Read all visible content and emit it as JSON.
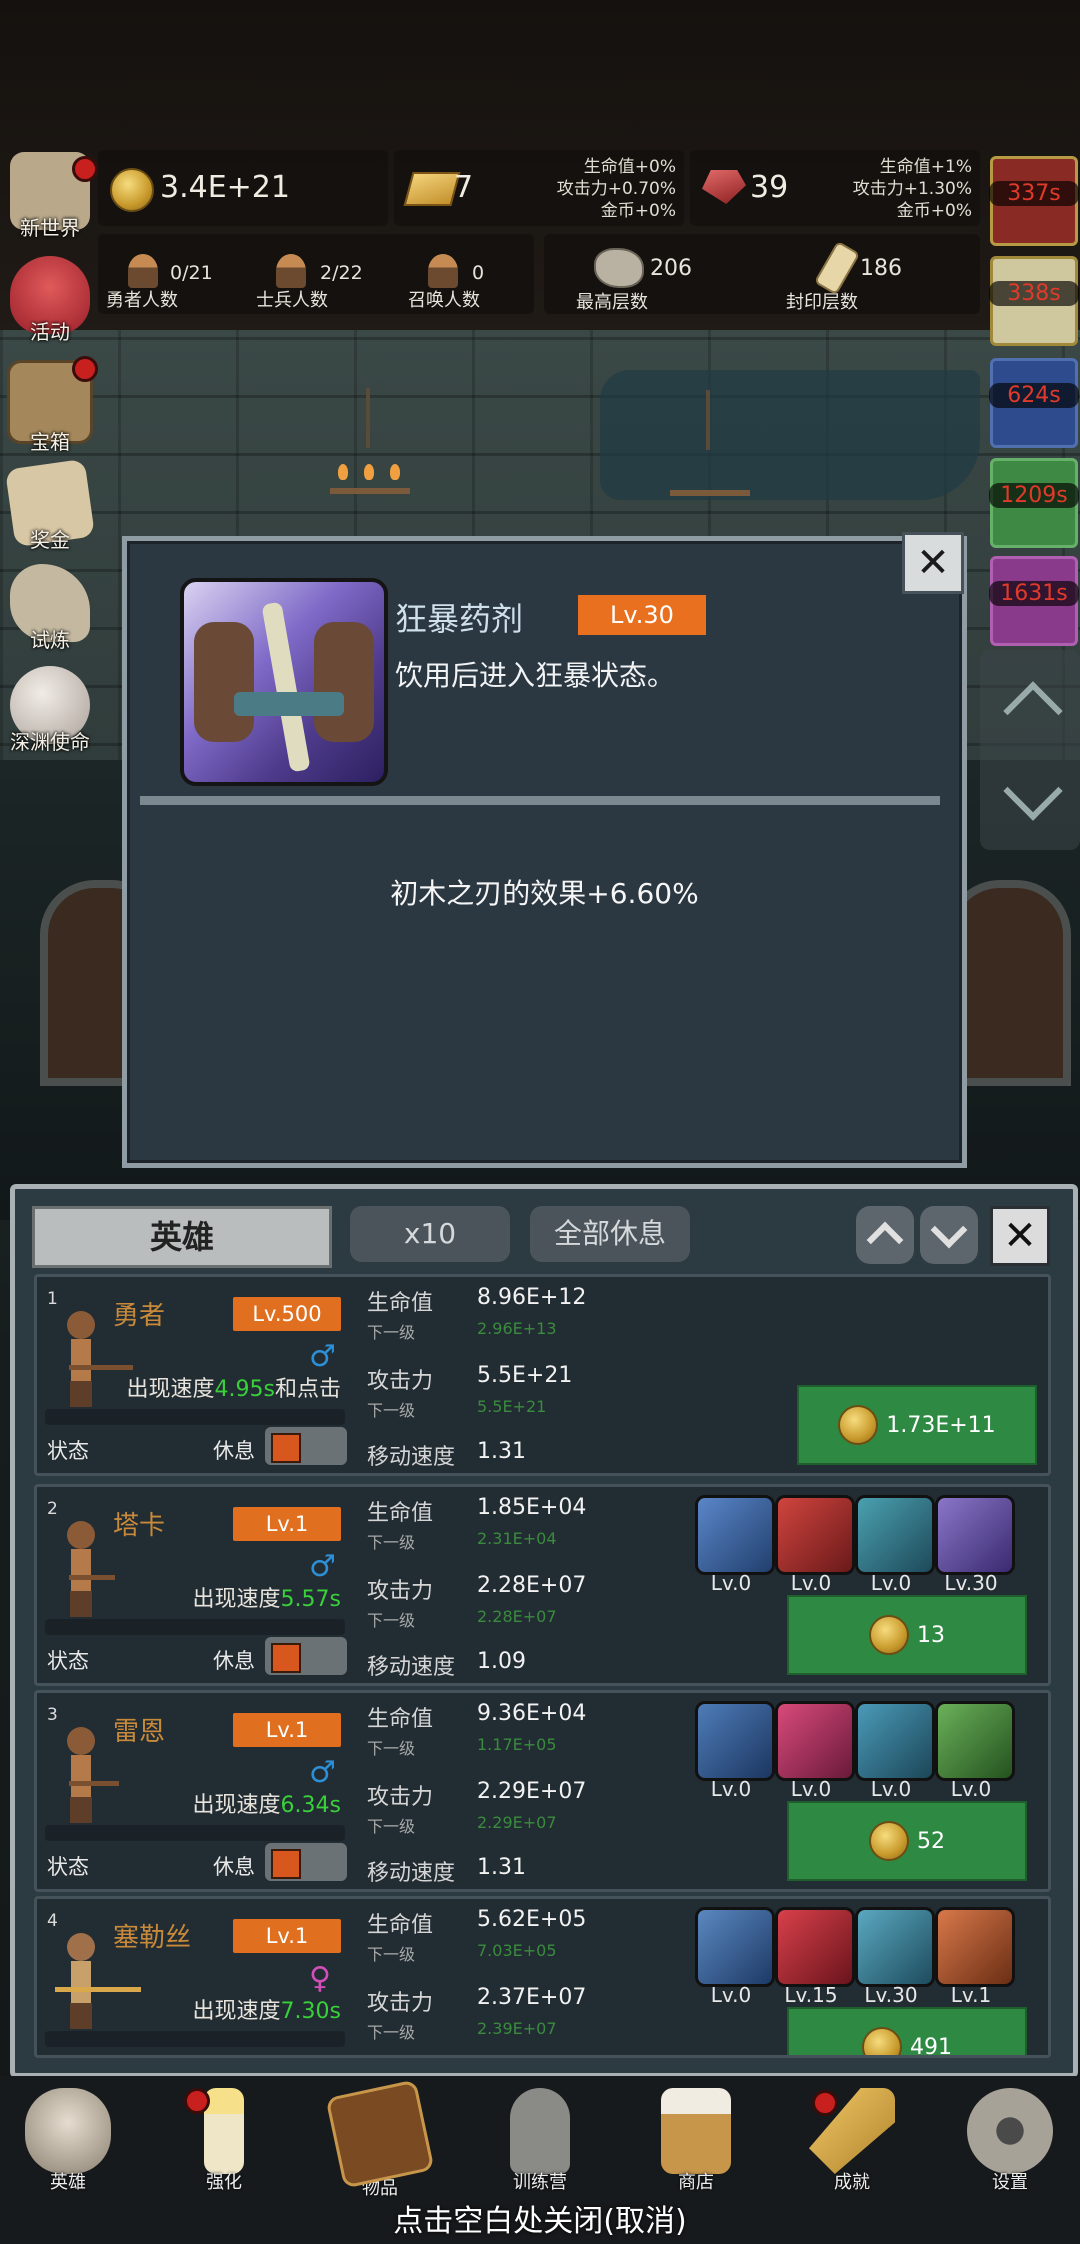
{
  "top_stats": {
    "coins": "3.4E+21",
    "gold_bars": "7",
    "gold_bonus": {
      "hp": "生命值+0%",
      "atk": "攻击力+0.70%",
      "coin": "金币+0%"
    },
    "rubies": "39",
    "ruby_bonus": {
      "hp": "生命值+1%",
      "atk": "攻击力+1.30%",
      "coin": "金币+0%"
    },
    "heroes_count": "0/21",
    "heroes_label": "勇者人数",
    "soldiers_count": "2/22",
    "soldiers_label": "士兵人数",
    "summon_count": "0",
    "summon_label": "召唤人数",
    "max_floor": "206",
    "max_floor_label": "最高层数",
    "seal_floor": "186",
    "seal_floor_label": "封印层数"
  },
  "left_menu": [
    {
      "label": "新世界"
    },
    {
      "label": "活动"
    },
    {
      "label": "宝箱"
    },
    {
      "label": "奖金"
    },
    {
      "label": "试炼"
    },
    {
      "label": "深渊使命"
    }
  ],
  "timers": [
    "337s",
    "338s",
    "624s",
    "1209s",
    "1631s"
  ],
  "popup": {
    "title": "狂暴药剂",
    "level": "Lv.30",
    "description": "饮用后进入狂暴状态。",
    "effect": "初木之刃的效果+6.60%",
    "close": "✕"
  },
  "panel": {
    "tab_hero": "英雄",
    "multiplier": "x10",
    "rest_all": "全部休息",
    "close": "✕",
    "status_label": "状态",
    "rest_label": "休息",
    "hp_label": "生命值",
    "atk_label": "攻击力",
    "next_label": "下一级",
    "speed_label": "移动速度",
    "heroes": [
      {
        "num": "1",
        "name": "勇者",
        "lv": "Lv.500",
        "gender": "♂",
        "spawn_prefix": "出现速度",
        "spawn_val": "4.95s",
        "spawn_suffix": "和点击",
        "hp": "8.96E+12",
        "hp_next": "2.96E+13",
        "atk": "5.5E+21",
        "atk_next": "5.5E+21",
        "speed": "1.31",
        "cost": "1.73E+11",
        "equips": []
      },
      {
        "num": "2",
        "name": "塔卡",
        "lv": "Lv.1",
        "gender": "♂",
        "spawn_prefix": "出现速度",
        "spawn_val": "5.57s",
        "spawn_suffix": "",
        "hp": "1.85E+04",
        "hp_next": "2.31E+04",
        "atk": "2.28E+07",
        "atk_next": "2.28E+07",
        "speed": "1.09",
        "cost": "13",
        "equips": [
          "Lv.0",
          "Lv.0",
          "Lv.0",
          "Lv.30"
        ]
      },
      {
        "num": "3",
        "name": "雷恩",
        "lv": "Lv.1",
        "gender": "♂",
        "spawn_prefix": "出现速度",
        "spawn_val": "6.34s",
        "spawn_suffix": "",
        "hp": "9.36E+04",
        "hp_next": "1.17E+05",
        "atk": "2.29E+07",
        "atk_next": "2.29E+07",
        "speed": "1.31",
        "cost": "52",
        "equips": [
          "Lv.0",
          "Lv.0",
          "Lv.0",
          "Lv.0"
        ]
      },
      {
        "num": "4",
        "name": "塞勒丝",
        "lv": "Lv.1",
        "gender": "♀",
        "spawn_prefix": "出现速度",
        "spawn_val": "7.30s",
        "spawn_suffix": "",
        "hp": "5.62E+05",
        "hp_next": "7.03E+05",
        "atk": "2.37E+07",
        "atk_next": "2.39E+07",
        "speed": "",
        "cost": "491",
        "equips": [
          "Lv.0",
          "Lv.15",
          "Lv.30",
          "Lv.1"
        ]
      }
    ]
  },
  "bottom_nav": [
    {
      "label": "英雄"
    },
    {
      "label": "强化"
    },
    {
      "label": "物品"
    },
    {
      "label": "训练营"
    },
    {
      "label": "商店"
    },
    {
      "label": "成就"
    },
    {
      "label": "设置"
    }
  ],
  "close_hint": "点击空白处关闭(取消)",
  "colors": {
    "accent_orange": "#e8701e",
    "buy_green": "#2e8a43",
    "timer_red": "#e23a2a",
    "spawn_green": "#39d03a"
  }
}
